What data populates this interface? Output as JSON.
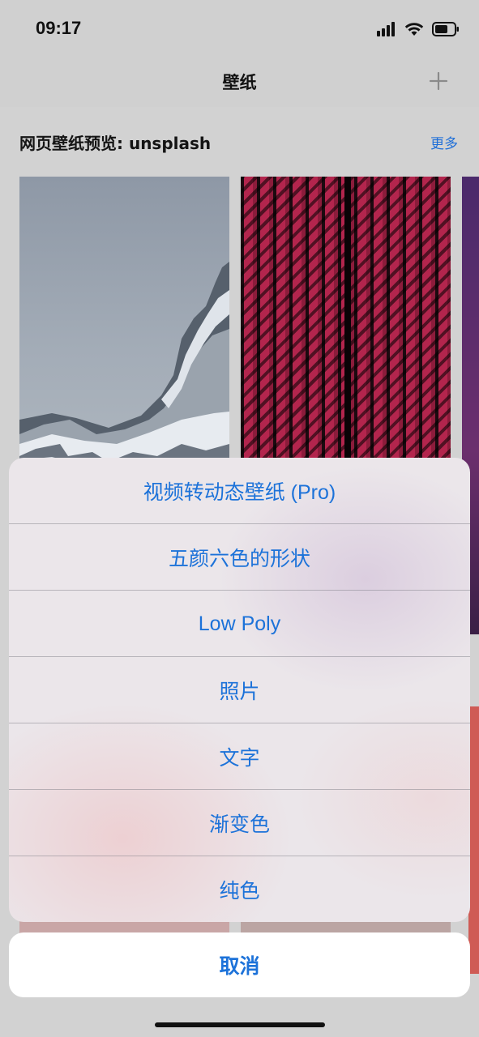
{
  "status_bar": {
    "time": "09:17"
  },
  "nav": {
    "title": "壁纸",
    "add_icon": "plus-icon"
  },
  "section": {
    "title": "网页壁纸预览: unsplash",
    "more": "更多"
  },
  "action_sheet": {
    "items": [
      {
        "label": "视频转动态壁纸 (Pro)"
      },
      {
        "label": "五颜六色的形状"
      },
      {
        "label": "Low Poly"
      },
      {
        "label": "照片"
      },
      {
        "label": "文字"
      },
      {
        "label": "渐变色"
      },
      {
        "label": "纯色"
      }
    ],
    "cancel": "取消"
  },
  "colors": {
    "accent": "#1c72d9"
  }
}
